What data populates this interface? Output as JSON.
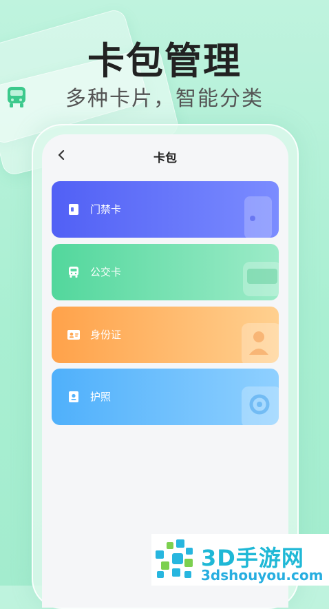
{
  "hero": {
    "title": "卡包管理",
    "subtitle": "多种卡片，智能分类"
  },
  "screen": {
    "nav_title": "卡包",
    "back_icon": "chevron-left-icon"
  },
  "cards": [
    {
      "label": "门禁卡",
      "icon": "door-card-icon",
      "color_from": "#5160f5",
      "color_to": "#7b8cff"
    },
    {
      "label": "公交卡",
      "icon": "bus-icon",
      "color_from": "#52d79c",
      "color_to": "#9cebc8"
    },
    {
      "label": "身份证",
      "icon": "id-card-icon",
      "color_from": "#ffa24a",
      "color_to": "#ffd08f"
    },
    {
      "label": "护照",
      "icon": "passport-icon",
      "color_from": "#4fb0fb",
      "color_to": "#8fd0ff"
    }
  ],
  "watermark": {
    "name": "3D手游网",
    "url": "3dshouyou.com"
  }
}
